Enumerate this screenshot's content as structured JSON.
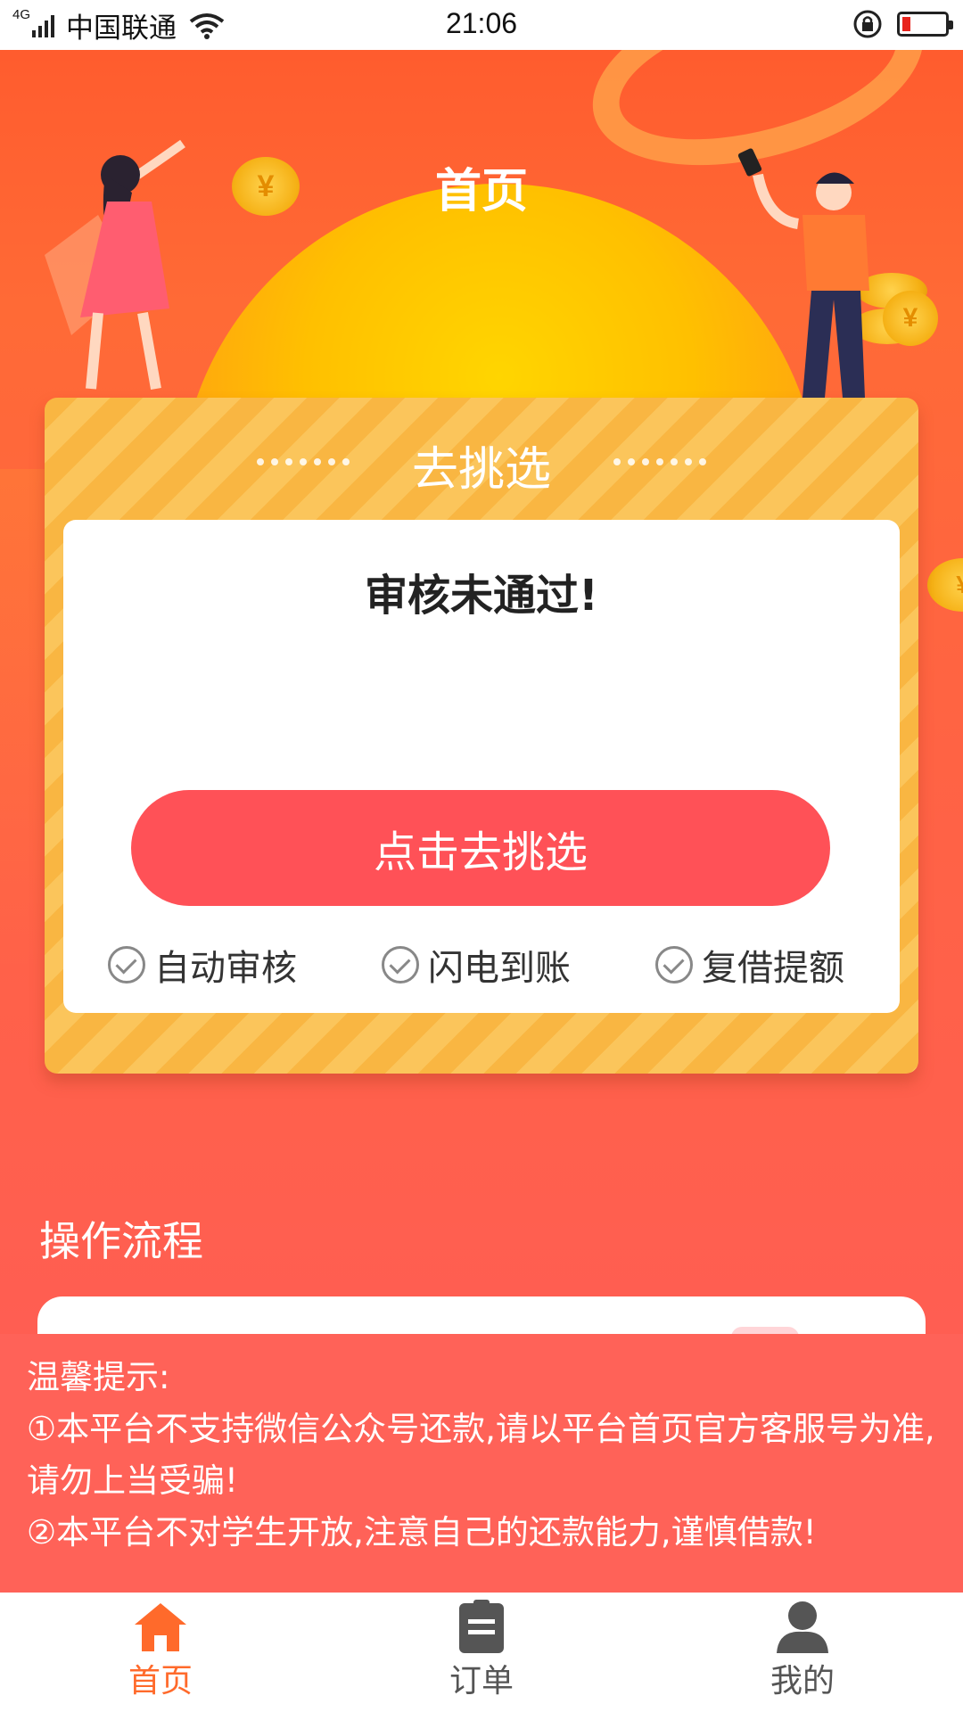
{
  "status_bar": {
    "network": "4G",
    "carrier": "中国联通",
    "time": "21:06",
    "battery_level": 0.18,
    "battery_color": "#e8241d"
  },
  "header": {
    "title": "首页"
  },
  "card": {
    "header_label": "去挑选",
    "status_message": "审核未通过!",
    "cta_label": "点击去挑选",
    "features": [
      "自动审核",
      "闪电到账",
      "复借提额"
    ]
  },
  "process": {
    "title": "操作流程",
    "steps": [
      {
        "icon": "id-card-icon"
      },
      {
        "icon": "form-edit-icon"
      },
      {
        "icon": "yen-icon"
      }
    ]
  },
  "notice": {
    "title": "温馨提示:",
    "line1": "①本平台不支持微信公众号还款,请以平台首页官方客服号为准,请勿上当受骗!",
    "line2": "②本平台不对学生开放,注意自己的还款能力,谨慎借款!"
  },
  "tabbar": {
    "items": [
      {
        "label": "首页",
        "icon": "home-icon",
        "active": true
      },
      {
        "label": "订单",
        "icon": "clipboard-icon",
        "active": false
      },
      {
        "label": "我的",
        "icon": "user-icon",
        "active": false
      }
    ],
    "active_color": "#ff6a2b"
  }
}
